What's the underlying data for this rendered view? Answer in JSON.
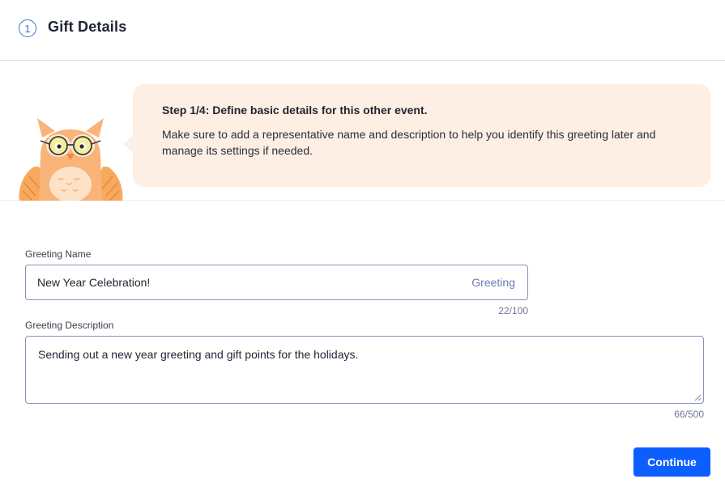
{
  "header": {
    "step_number": "1",
    "title": "Gift Details"
  },
  "banner": {
    "illustration": "owl-mascot-icon",
    "title": "Step 1/4: Define basic details for this other event.",
    "text": "Make sure to add a representative name and description to help you identify this greeting later and manage its settings if needed."
  },
  "form": {
    "name": {
      "label": "Greeting Name",
      "value": "New Year Celebration!",
      "suffix": "Greeting",
      "counter": "22/100"
    },
    "description": {
      "label": "Greeting Description",
      "value": "Sending out a new year greeting and gift points for the holidays.",
      "counter": "66/500"
    }
  },
  "actions": {
    "continue_label": "Continue"
  },
  "colors": {
    "accent": "#0d5eff",
    "step_circle": "#3d6fd8",
    "banner_bg": "#fdefe3",
    "input_border": "#8d8fb7"
  }
}
